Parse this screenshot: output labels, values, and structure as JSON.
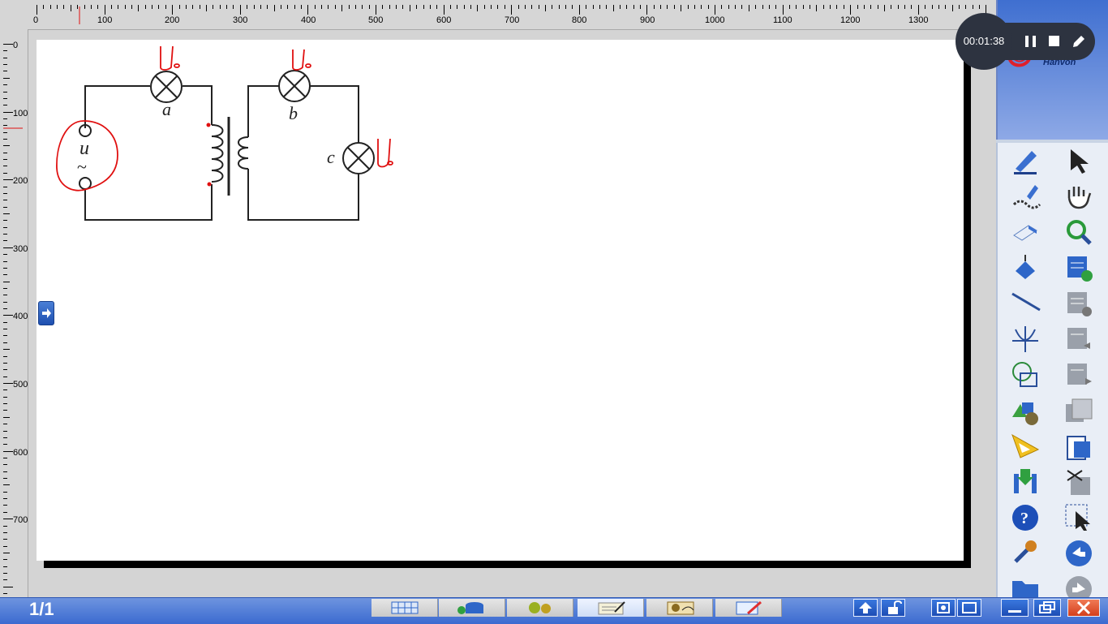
{
  "ruler": {
    "top_labels": [
      "0",
      "100",
      "200",
      "300",
      "400",
      "500",
      "600",
      "700",
      "800",
      "900",
      "1000",
      "1100",
      "1200",
      "1300"
    ],
    "left_labels": [
      "0",
      "100",
      "200",
      "300",
      "400",
      "500",
      "600",
      "700"
    ]
  },
  "diagram": {
    "source_symbol": "u",
    "source_tilde": "~",
    "lamp_a_label": "a",
    "lamp_b_label": "b",
    "lamp_c_label": "c"
  },
  "logo": {
    "brand": "Hanvon"
  },
  "recorder": {
    "elapsed": "00:01:38"
  },
  "bottom_bar": {
    "page_counter": "1/1"
  },
  "colors": {
    "ink_red": "#e01010",
    "panel_blue": "#3f6fd0",
    "recorder_bg": "#2d3340"
  },
  "tools_left": [
    "pen-icon",
    "magic-pen-icon",
    "eraser-icon",
    "fill-bucket-icon",
    "line-icon",
    "axis-icon",
    "shapes-icon",
    "3d-shapes-icon",
    "ruler-triangle-icon",
    "download-icon",
    "help-icon",
    "wrench-icon",
    "folder-icon"
  ],
  "tools_right": [
    "select-arrow-icon",
    "hand-icon",
    "magnifier-icon",
    "new-page-icon",
    "delete-page-icon",
    "prev-page-icon",
    "next-page-icon",
    "page-list-icon",
    "clipboard-icon",
    "cut-icon",
    "area-select-icon",
    "back-icon",
    "forward-icon"
  ]
}
